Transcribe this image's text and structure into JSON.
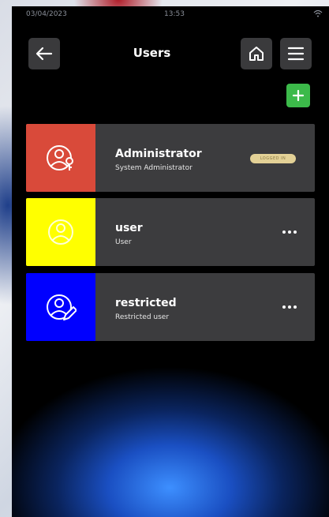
{
  "status_bar": {
    "date": "03/04/2023",
    "time": "13:53",
    "wifi_icon": "wifi-icon"
  },
  "header": {
    "title": "Users",
    "back_icon": "arrow-left-icon",
    "home_icon": "home-icon",
    "menu_icon": "hamburger-menu-icon"
  },
  "add_button": {
    "icon": "plus-icon",
    "color": "#3cba4a"
  },
  "users": [
    {
      "name": "Administrator",
      "description": "System Administrator",
      "color": "#d94a3a",
      "icon": "user-key-icon",
      "badge": "LOGGED IN"
    },
    {
      "name": "user",
      "description": "User",
      "color": "#ffff00",
      "icon": "user-icon",
      "more_icon": "more-dots-icon"
    },
    {
      "name": "restricted",
      "description": "Restricted user",
      "color": "#0000ff",
      "icon": "user-pencil-icon",
      "more_icon": "more-dots-icon"
    }
  ]
}
